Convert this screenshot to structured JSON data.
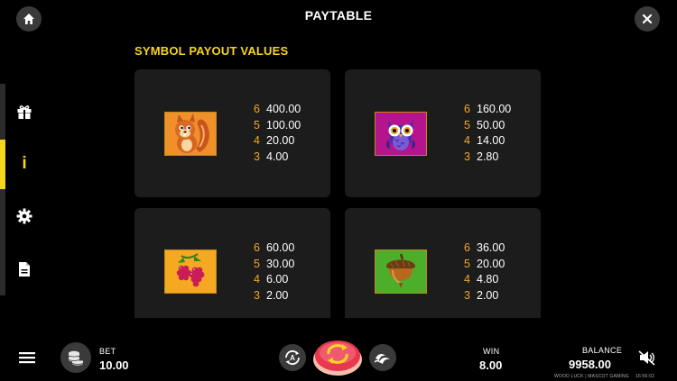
{
  "header": {
    "title": "PAYTABLE"
  },
  "section": {
    "title": "SYMBOL PAYOUT VALUES"
  },
  "sidebar": {
    "items": [
      {
        "name": "gift",
        "icon": "gift-icon"
      },
      {
        "name": "info",
        "icon": "info-icon",
        "label": "i",
        "active": true
      },
      {
        "name": "settings",
        "icon": "gear-icon"
      },
      {
        "name": "rules",
        "icon": "document-icon"
      }
    ]
  },
  "symbols": [
    {
      "name": "squirrel",
      "icon": "squirrel-icon",
      "bg": "#f0902a",
      "payouts": [
        {
          "count": "6",
          "value": "400.00"
        },
        {
          "count": "5",
          "value": "100.00"
        },
        {
          "count": "4",
          "value": "20.00"
        },
        {
          "count": "3",
          "value": "4.00"
        }
      ]
    },
    {
      "name": "owl",
      "icon": "owl-icon",
      "bg": "#b6148c",
      "payouts": [
        {
          "count": "6",
          "value": "160.00"
        },
        {
          "count": "5",
          "value": "50.00"
        },
        {
          "count": "4",
          "value": "14.00"
        },
        {
          "count": "3",
          "value": "2.80"
        }
      ]
    },
    {
      "name": "raspberries",
      "icon": "raspberry-icon",
      "bg": "#f5a821",
      "payouts": [
        {
          "count": "6",
          "value": "60.00"
        },
        {
          "count": "5",
          "value": "30.00"
        },
        {
          "count": "4",
          "value": "6.00"
        },
        {
          "count": "3",
          "value": "2.00"
        }
      ]
    },
    {
      "name": "acorn",
      "icon": "acorn-icon",
      "bg": "#4cae2a",
      "payouts": [
        {
          "count": "6",
          "value": "36.00"
        },
        {
          "count": "5",
          "value": "20.00"
        },
        {
          "count": "4",
          "value": "4.80"
        },
        {
          "count": "3",
          "value": "2.00"
        }
      ]
    }
  ],
  "bottom": {
    "bet_label": "BET",
    "bet_value": "10.00",
    "win_label": "WIN",
    "win_value": "8.00",
    "balance_label": "BALANCE",
    "balance_value": "9958.00",
    "footer_text": "WOOD LUCK | MASCOT GAMING",
    "clock": "16:56:02"
  },
  "colors": {
    "accent": "#f6d520",
    "count": "#f6a623",
    "card": "#1c1c1c",
    "spin": "#e8374f"
  }
}
